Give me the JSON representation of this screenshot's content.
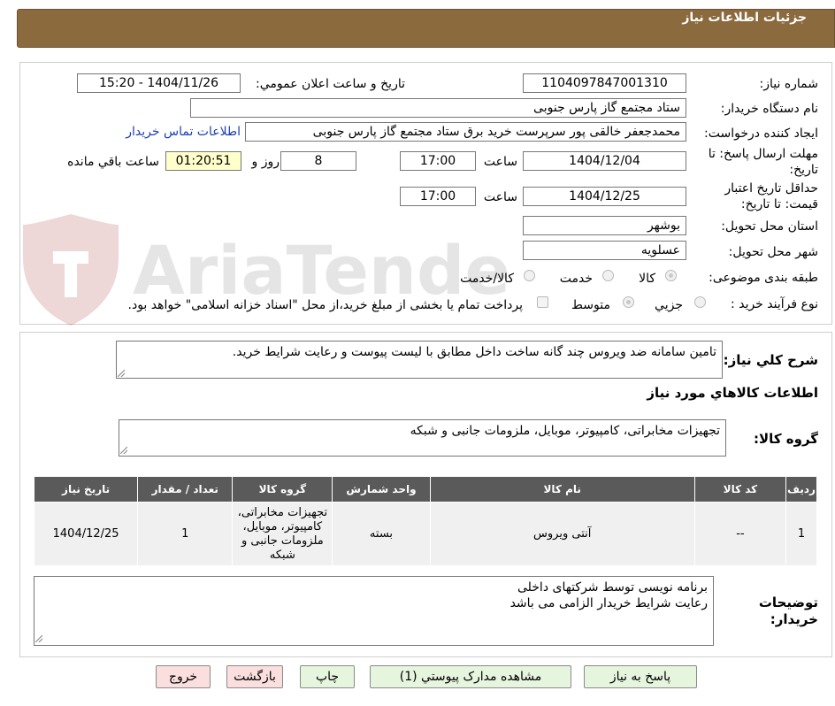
{
  "header": {
    "title": "جزئیات اطلاعات نیاز"
  },
  "watermark": {
    "text": "AriaTender.neT"
  },
  "fields": {
    "need_number_label": "شماره نیاز:",
    "need_number": "1104097847001310",
    "announce_label": "تاریخ و ساعت اعلان عمومي:",
    "announce_value": "1404/11/26 - 15:20",
    "buyer_org_label": "نام دستگاه خریدار:",
    "buyer_org": "ستاد مجتمع گاز پارس جنوبی",
    "creator_label": "ایجاد کننده درخواست:",
    "creator": "محمدجعفر خالقی پور سرپرست خرید برق ستاد مجتمع گاز پارس جنوبی",
    "contact_link": "اطلاعات تماس خریدار",
    "deadline_label_line1": "مهلت ارسال پاسخ: تا",
    "deadline_label_line2": "تاریخ:",
    "deadline_date": "1404/12/04",
    "time_label": "ساعت",
    "deadline_time": "17:00",
    "days_value": "8",
    "days_label": "روز و",
    "remaining_time": "01:20:51",
    "remaining_label": "ساعت باقي مانده",
    "validity_label_line1": "حداقل تاریخ اعتبار",
    "validity_label_line2": "قیمت: تا تاریخ:",
    "validity_date": "1404/12/25",
    "validity_time_label": "ساعت",
    "validity_time": "17:00",
    "province_label": "استان محل تحویل:",
    "province": "بوشهر",
    "city_label": "شهر محل تحویل:",
    "city": "عسلویه",
    "category_label": "طبقه بندی موضوعی:",
    "category_options": [
      "کالا",
      "خدمت",
      "کالا/خدمت"
    ],
    "process_label": "نوع فرآیند خرید :",
    "process_options": [
      "جزیي",
      "متوسط"
    ],
    "payment_note": "پرداخت تمام یا بخشی از مبلغ خرید،از محل \"اسناد خزانه اسلامی\" خواهد بود."
  },
  "description": {
    "label": "شرح کلي نیاز:",
    "text": "تامین سامانه ضد ویروس چند گانه ساخت داخل مطابق با لیست پیوست و رعایت شرایط خرید."
  },
  "goods_section": {
    "title": "اطلاعات کالاهاي مورد نیاز",
    "group_label": "گروه کالا:",
    "group_value": "تجهیزات مخابراتی، کامپیوتر، موبایل، ملزومات جانبی و شبکه"
  },
  "table": {
    "headers": [
      "ردیف",
      "کد کالا",
      "نام کالا",
      "واحد شمارش",
      "گروه کالا",
      "تعداد / مقدار",
      "تاریخ نیاز"
    ],
    "rows": [
      [
        "1",
        "--",
        "آنتی ویروس",
        "بسته",
        "تجهیزات مخابراتی، کامپیوتر، موبایل، ملزومات جانبی و شبکه",
        "1",
        "1404/12/25"
      ]
    ]
  },
  "buyer_notes": {
    "label_line1": "توضیحات",
    "label_line2": "خریدار:",
    "line1": "برنامه نویسی توسط شرکتهای داخلی",
    "line2": "رعایت شرایط خریدار الزامی می باشد"
  },
  "buttons": {
    "reply": "پاسخ به نیاز",
    "attachments": "مشاهده مدارک پیوستي (1)",
    "print": "چاپ",
    "back": "بازگشت",
    "exit": "خروج"
  }
}
